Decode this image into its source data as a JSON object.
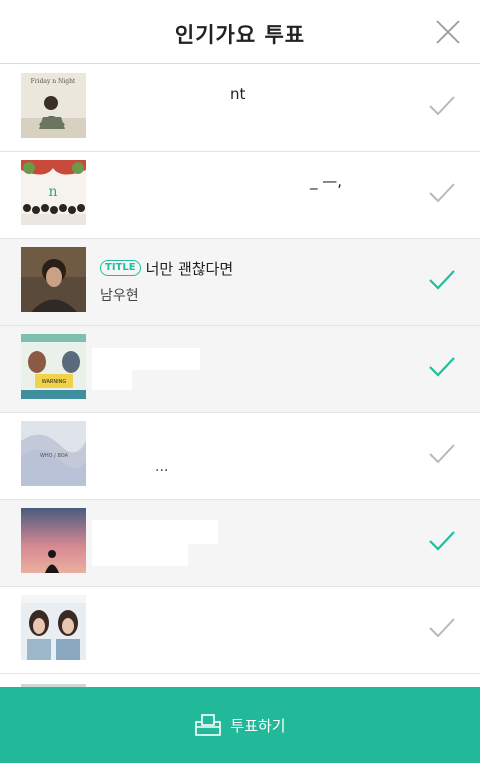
{
  "header": {
    "title": "인기가요 투표"
  },
  "songs": [
    {
      "title": "nt",
      "artist": "",
      "badge": "",
      "selected": false,
      "album_text": "Friday n Night"
    },
    {
      "title": "_ —,",
      "artist": "",
      "badge": "",
      "selected": false
    },
    {
      "title": "너만 괜찮다면",
      "artist": "남우현",
      "badge": "TITLE",
      "selected": true
    },
    {
      "title": "",
      "artist": "",
      "badge": "",
      "selected": true,
      "album_text": "WARNING"
    },
    {
      "title": "",
      "artist": "...",
      "badge": "",
      "selected": false,
      "album_text": "WHO / BOA"
    },
    {
      "title": "",
      "artist": "",
      "badge": "",
      "selected": true
    },
    {
      "title": "",
      "artist": "",
      "badge": "",
      "selected": false
    }
  ],
  "footer": {
    "vote_label": "투표하기"
  },
  "colors": {
    "accent": "#22b89a",
    "check_on": "#1fbf9f",
    "check_off": "#b8b8b8"
  }
}
